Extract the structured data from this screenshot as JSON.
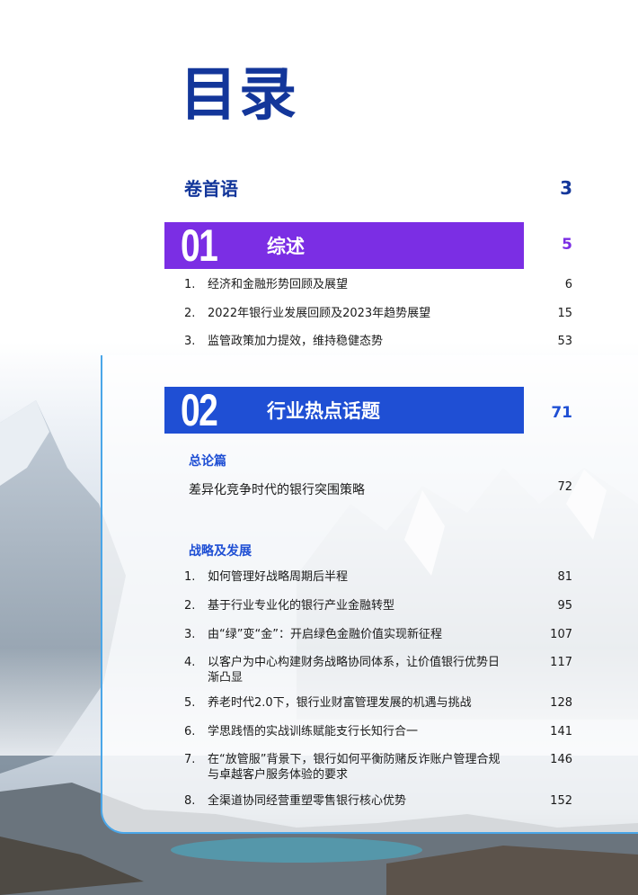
{
  "title": "目录",
  "preface": {
    "label": "卷首语",
    "page": "3"
  },
  "sections": [
    {
      "number": "01",
      "name": "综述",
      "page": "5",
      "color": "#7b2ee4",
      "items": [
        {
          "no": "1.",
          "text": "经济和金融形势回顾及展望",
          "page": "6"
        },
        {
          "no": "2.",
          "text": "2022年银行业发展回顾及2023年趋势展望",
          "page": "15"
        },
        {
          "no": "3.",
          "text": "监管政策加力提效，维持稳健态势",
          "page": "53"
        }
      ]
    },
    {
      "number": "02",
      "name": "行业热点话题",
      "page": "71",
      "color": "#1f4fd4",
      "groups": [
        {
          "heading": "总论篇",
          "items": [
            {
              "no": "",
              "text": "差异化竞争时代的银行突围策略",
              "page": "72"
            }
          ]
        },
        {
          "heading": "战略及发展",
          "items": [
            {
              "no": "1.",
              "text": "如何管理好战略周期后半程",
              "page": "81"
            },
            {
              "no": "2.",
              "text": "基于行业专业化的银行产业金融转型",
              "page": "95"
            },
            {
              "no": "3.",
              "text": "由“绿”变“金”：开启绿色金融价值实现新征程",
              "page": "107"
            },
            {
              "no": "4.",
              "text": "以客户为中心构建财务战略协同体系，让价值银行优势日渐凸显",
              "page": "117"
            },
            {
              "no": "5.",
              "text": "养老时代2.0下，银行业财富管理发展的机遇与挑战",
              "page": "128"
            },
            {
              "no": "6.",
              "text": "学思践悟的实战训练赋能支行长知行合一",
              "page": "141"
            },
            {
              "no": "7.",
              "text": "在“放管服”背景下，银行如何平衡防赌反诈账户管理合规与卓越客户服务体验的要求",
              "page": "146"
            },
            {
              "no": "8.",
              "text": "全渠道协同经营重塑零售银行核心优势",
              "page": "152"
            }
          ]
        }
      ]
    }
  ]
}
